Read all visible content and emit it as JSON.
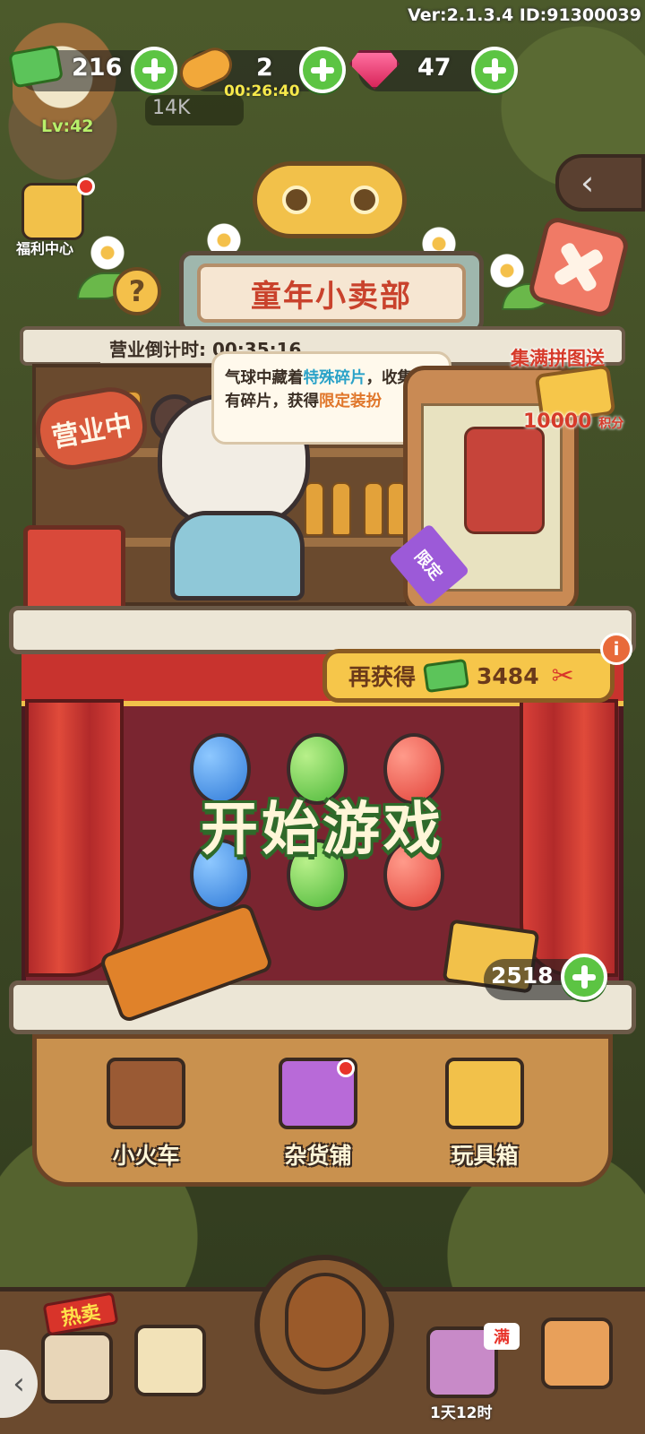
{
  "version_text": "Ver:2.1.3.4 ID:91300039",
  "player": {
    "level": "Lv:42",
    "followers": "14K"
  },
  "currency": {
    "tickets": "216",
    "candy": "2",
    "candy_timer": "00:26:40",
    "gems": "47"
  },
  "side_left": {
    "welfare_label": "福利中心"
  },
  "shop": {
    "title": "童年小卖部",
    "countdown_label": "营业倒计时:",
    "countdown_value": "00:35:16",
    "open_sign": "营业中",
    "question": "?",
    "bubble": {
      "part1": "气球中藏着",
      "highlight1": "特殊碎片",
      "part2": "，收集所有碎片，获得",
      "highlight2": "限定装扮"
    },
    "puzzle": {
      "title": "集满拼图送",
      "points": "10000",
      "points_unit": "积分",
      "limited_tag": "限定"
    }
  },
  "game": {
    "reward_label": "再获得",
    "reward_value": "3484",
    "info": "i",
    "start_button": "开始游戏",
    "ammo_count": "2518"
  },
  "nav": {
    "items": [
      {
        "label": "小火车",
        "icon": "train-cart-icon"
      },
      {
        "label": "杂货铺",
        "icon": "shopping-bag-icon"
      },
      {
        "label": "玩具箱",
        "icon": "toy-box-icon"
      }
    ]
  },
  "dock": {
    "hot_badge": "热卖",
    "full_badge": "满",
    "timer": "1天12时",
    "left_arrow": "‹",
    "back_arrow": "‹"
  },
  "colors": {
    "accent_green": "#5cc443",
    "title_red": "#c9422c",
    "highlight_blue": "#2aa2c8",
    "highlight_orange": "#e0762a",
    "curtain_red": "#c8332e"
  }
}
